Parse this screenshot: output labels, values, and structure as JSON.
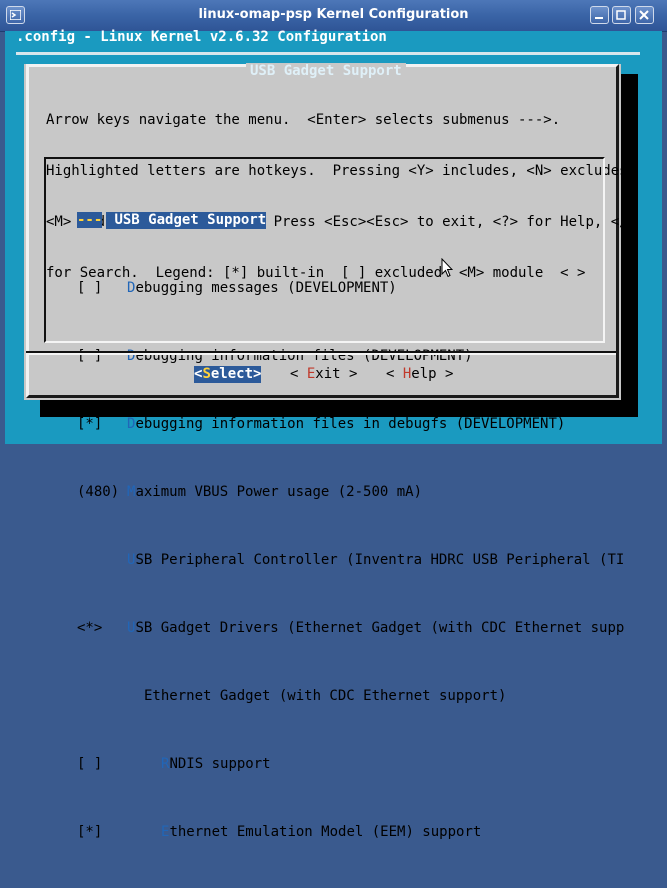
{
  "window": {
    "title": "linux-omap-psp Kernel Configuration"
  },
  "terminal": {
    "header": ".config - Linux Kernel v2.6.32 Configuration"
  },
  "dialog": {
    "title": "USB Gadget Support",
    "help_lines": [
      "Arrow keys navigate the menu.  <Enter> selects submenus --->.",
      "Highlighted letters are hotkeys.  Pressing <Y> includes, <N> excludes,",
      "<M> modularizes features.  Press <Esc><Esc> to exit, <?> for Help, </>",
      "for Search.  Legend: [*] built-in  [ ] excluded  <M> module  < >"
    ]
  },
  "menu": {
    "items": [
      {
        "marker": "---",
        "hot": "",
        "text": "USB Gadget Support",
        "selected": true
      },
      {
        "marker": "[ ]",
        "hot": "D",
        "text": "ebugging messages (DEVELOPMENT)"
      },
      {
        "marker": "[ ]",
        "hot": "D",
        "text": "ebugging information files (DEVELOPMENT)"
      },
      {
        "marker": "[*]",
        "hot": "D",
        "text": "ebugging information files in debugfs (DEVELOPMENT)"
      },
      {
        "marker": "(480)",
        "hot": "M",
        "text": "aximum VBUS Power usage (2-500 mA)"
      },
      {
        "marker": "",
        "hot": "U",
        "text": "SB Peripheral Controller (Inventra HDRC USB Peripheral (TI"
      },
      {
        "marker": "<*>",
        "hot": "U",
        "text": "SB Gadget Drivers (Ethernet Gadget (with CDC Ethernet supp"
      },
      {
        "marker": "",
        "hot": "",
        "text": "Ethernet Gadget (with CDC Ethernet support)"
      },
      {
        "marker": "[ ]",
        "hot": "R",
        "text": "NDIS support"
      },
      {
        "marker": "[*]",
        "hot": "E",
        "text": "thernet Emulation Model (EEM) support"
      }
    ]
  },
  "buttons": {
    "select": {
      "open": "<",
      "key": "S",
      "rest": "elect",
      "close": ">"
    },
    "exit": {
      "open": "< ",
      "key": "E",
      "rest": "xit",
      "close": " >"
    },
    "help": {
      "open": "< ",
      "key": "H",
      "rest": "elp",
      "close": " >"
    }
  },
  "colors": {
    "terminal_bg": "#1a9ac0",
    "dialog_bg": "#c8c8c8",
    "selection": "#2c5a9a",
    "hotkey": "#2166b8",
    "button_hotkey": "#c0392b"
  },
  "icons": [
    "window-menu-icon",
    "minimize-icon",
    "maximize-icon",
    "close-icon",
    "mouse-pointer-icon"
  ]
}
